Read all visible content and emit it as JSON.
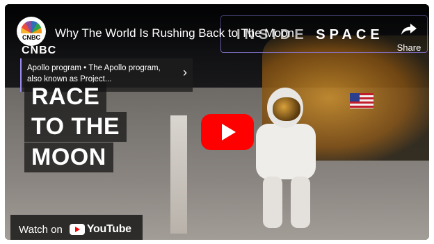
{
  "player": {
    "channel_logo_text": "CNBC",
    "title": "Why The World Is Rushing Back to The Moon",
    "series_title_a": "INSIDE ",
    "series_title_b": "SPACE",
    "share_label": "Share",
    "watermark": "CNBC"
  },
  "info_card": {
    "text": "Apollo program • The Apollo program, also known as Project..."
  },
  "headline": {
    "line1": "RACE",
    "line2": "TO THE",
    "line3": "MOON"
  },
  "footer": {
    "watch_on_label": "Watch on",
    "youtube_label": "YouTube"
  },
  "colors": {
    "play_button": "#ff0000",
    "card_accent": "#9b8df0"
  },
  "icons": {
    "share": "share-arrow-icon",
    "play": "play-icon",
    "info_chevron": "chevron-right-icon",
    "youtube": "youtube-logo-icon"
  }
}
